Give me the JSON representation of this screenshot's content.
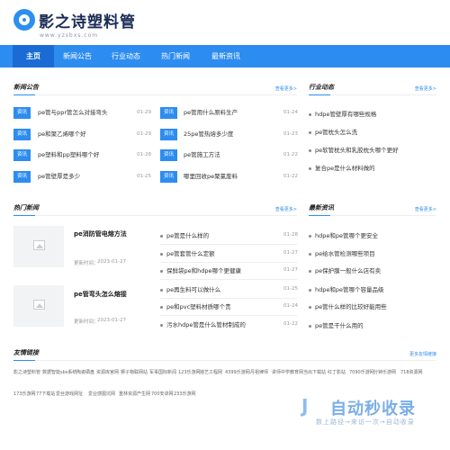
{
  "brand": {
    "title": "影之诗塑料管",
    "subtitle": "www.yzsbxs.com"
  },
  "nav": [
    "主页",
    "新闻公告",
    "行业动态",
    "热门新闻",
    "最新资讯"
  ],
  "news": {
    "title": "新闻公告",
    "more": "查看更多>",
    "items": [
      {
        "tag": "资讯",
        "text": "pe管与ppr管怎么对接弯头",
        "date": "01-29"
      },
      {
        "tag": "资讯",
        "text": "pe管用什么原料生产",
        "date": "01-24"
      },
      {
        "tag": "资讯",
        "text": "pe和聚乙烯哪个好",
        "date": "01-29"
      },
      {
        "tag": "资讯",
        "text": "25pe管热熔多少度",
        "date": "01-23"
      },
      {
        "tag": "资讯",
        "text": "pe塑料和pp塑料哪个好",
        "date": "01-28"
      },
      {
        "tag": "资讯",
        "text": "pe管施工方法",
        "date": "01-22"
      },
      {
        "tag": "资讯",
        "text": "pe管壁厚是多少",
        "date": "01-25"
      },
      {
        "tag": "资讯",
        "text": "哪里回收pe聚氯废料",
        "date": "01-22"
      }
    ]
  },
  "industry": {
    "title": "行业动态",
    "more": "查看更多>",
    "items": [
      "hdpe管壁厚有哪些规格",
      "pe管枕头怎么洗",
      "pe软管枕头和乳胶枕头哪个更好",
      "复合pe是什么材料做的"
    ]
  },
  "hot": {
    "title": "热门新闻",
    "more": "查看更多>",
    "cards": [
      {
        "title": "pe消防管电熔方法",
        "time_label": "更新时间：",
        "time": "2023-01-27"
      },
      {
        "title": "pe管弯头怎么熔接",
        "time_label": "更新时间：",
        "time": "2023-01-27"
      }
    ],
    "items": [
      {
        "text": "pe管是什么样的",
        "date": "01-28"
      },
      {
        "text": "pe管套管什么定额",
        "date": "01-27"
      },
      {
        "text": "保鲜袋pe和hdpe哪个更健康",
        "date": "01-27"
      },
      {
        "text": "pe再生料可以做什么",
        "date": "01-25"
      },
      {
        "text": "pe和pvc塑料材质哪个贵",
        "date": "01-24"
      },
      {
        "text": "污水hdpe管是什么管材制成的",
        "date": "01-22"
      }
    ]
  },
  "latest": {
    "title": "最新资讯",
    "more": "查看更多>",
    "items": [
      "hdpe和pe管哪个更安全",
      "pe给水管检测哪些项目",
      "pe保护膜一般什么店有卖",
      "hdpe和pe管哪个容量品级",
      "pe管什么样的比较好能用些",
      "pe管是干什么用的"
    ]
  },
  "links": {
    "title": "友情链接",
    "more": "更多友情链接",
    "row1": [
      "影之诗塑料管",
      "数据智能sbs系统",
      "陶瓷硒盘",
      "资源库官网",
      "狮子物联网站",
      "军事国际新闻",
      "123乐游网",
      "摇艺工程网",
      "4399乐游网",
      "丹祖律师",
      "讲师中学教育网",
      "当出下载站",
      "红丁影站",
      "7090乐游网",
      "分钟乐游网",
      "718资源网"
    ],
    "row2": [
      "173乐游网",
      "77下载站",
      "爱丝游戏网址",
      "爱业感图坑网",
      "重林资源产生网",
      "700安卓网",
      "233乐游网"
    ]
  },
  "watermark": {
    "title": "自动秒收录",
    "sub": "数上路径→来访一次→自动收录"
  },
  "colors": {
    "accent": "#2d8cf0",
    "nav_active": "#1a6cd4"
  }
}
